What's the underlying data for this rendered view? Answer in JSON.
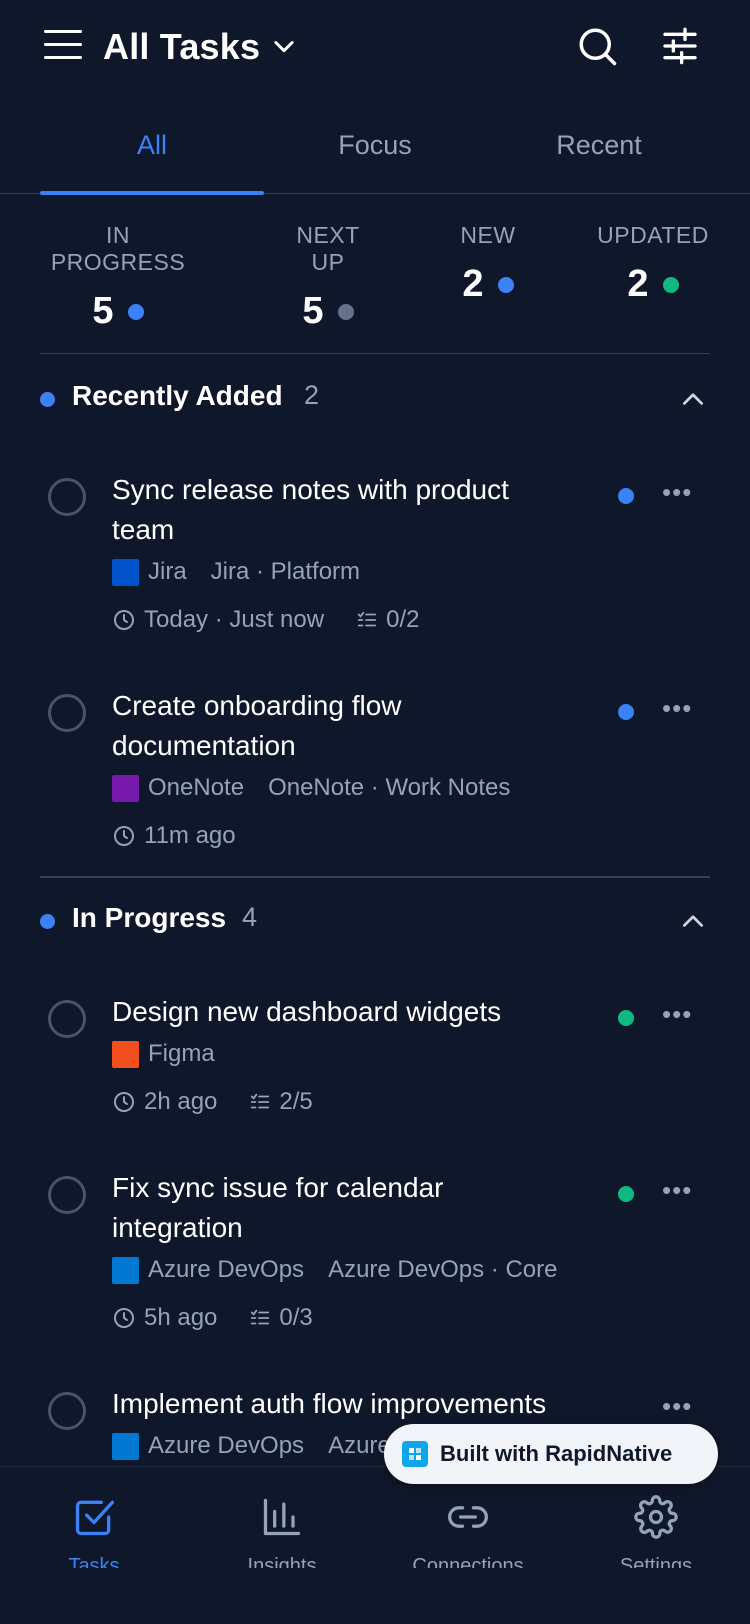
{
  "header": {
    "title": "All Tasks"
  },
  "tabs": [
    {
      "label": "All",
      "active": true
    },
    {
      "label": "Focus",
      "active": false
    },
    {
      "label": "Recent",
      "active": false
    }
  ],
  "stats": [
    {
      "label": "IN PROGRESS",
      "value": "5",
      "color": "#3b82f6"
    },
    {
      "label": "NEXT UP",
      "value": "5",
      "color": "#64748b"
    },
    {
      "label": "NEW",
      "value": "2",
      "color": "#3b82f6"
    },
    {
      "label": "UPDATED",
      "value": "2",
      "color": "#10b981"
    }
  ],
  "sections": [
    {
      "title": "Recently Added",
      "count": "2",
      "tasks": [
        {
          "title": "Sync release notes with product team",
          "source": "Jira",
          "source_color": "#0052cc",
          "path": "Jira · Platform",
          "time": "Today · Just now",
          "subtasks": "0/2",
          "status_color": "#3b82f6"
        },
        {
          "title": "Create onboarding flow documentation",
          "source": "OneNote",
          "source_color": "#7719aa",
          "path": "OneNote · Work Notes",
          "time": "11m ago",
          "subtasks": "",
          "status_color": "#3b82f6"
        }
      ]
    },
    {
      "title": "In Progress",
      "count": "4",
      "tasks": [
        {
          "title": "Design new dashboard widgets",
          "source": "Figma",
          "source_color": "#f24e1e",
          "path": "",
          "time": "2h ago",
          "subtasks": "2/5",
          "status_color": "#10b981"
        },
        {
          "title": "Fix sync issue for calendar integration",
          "source": "Azure DevOps",
          "source_color": "#0078d4",
          "path": "Azure DevOps · Core",
          "time": "5h ago",
          "subtasks": "0/3",
          "status_color": "#10b981"
        },
        {
          "title": "Implement auth flow improvements",
          "source": "Azure DevOps",
          "source_color": "#0078d4",
          "path": "Azure",
          "time": "",
          "subtasks": "",
          "status_color": ""
        }
      ]
    }
  ],
  "badge": {
    "text": "Built with RapidNative"
  },
  "nav": [
    {
      "icon": "tasks-checkbox-icon",
      "label": "Tasks",
      "active": true
    },
    {
      "icon": "insights-chart-icon",
      "label": "Insights",
      "active": false
    },
    {
      "icon": "connections-link-icon",
      "label": "Connections",
      "active": false
    },
    {
      "icon": "settings-gear-icon",
      "label": "Settings",
      "active": false
    }
  ],
  "colors": {
    "background": "#0f172a",
    "accent": "#3b82f6",
    "muted": "#94a3b8",
    "divider": "#334155"
  }
}
